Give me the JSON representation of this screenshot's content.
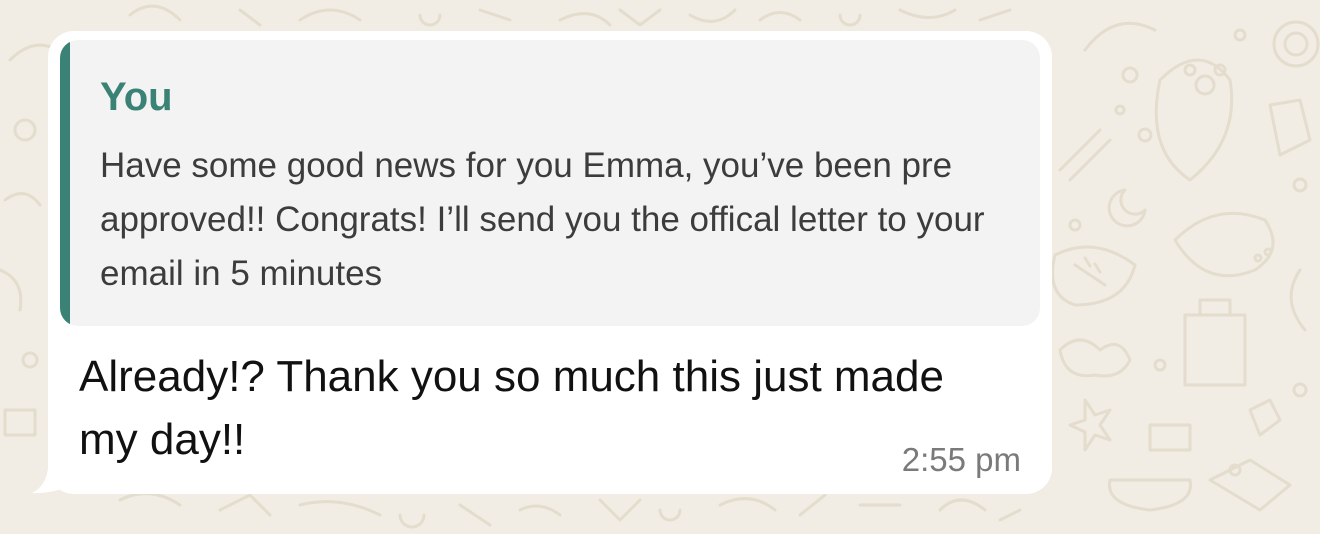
{
  "quoted_message": {
    "author": "You",
    "text": "Have some good news for you Emma, you’ve been pre approved!! Congrats! I’ll send you the offical letter to your email in 5 minutes"
  },
  "message": {
    "text": "Already!? Thank you so much this just made my day!!",
    "time": "2:55 pm"
  },
  "colors": {
    "wallpaper": "#f1ede4",
    "bubble": "#ffffff",
    "quote_background": "#f3f3f3",
    "quote_accent": "#3a8275"
  }
}
